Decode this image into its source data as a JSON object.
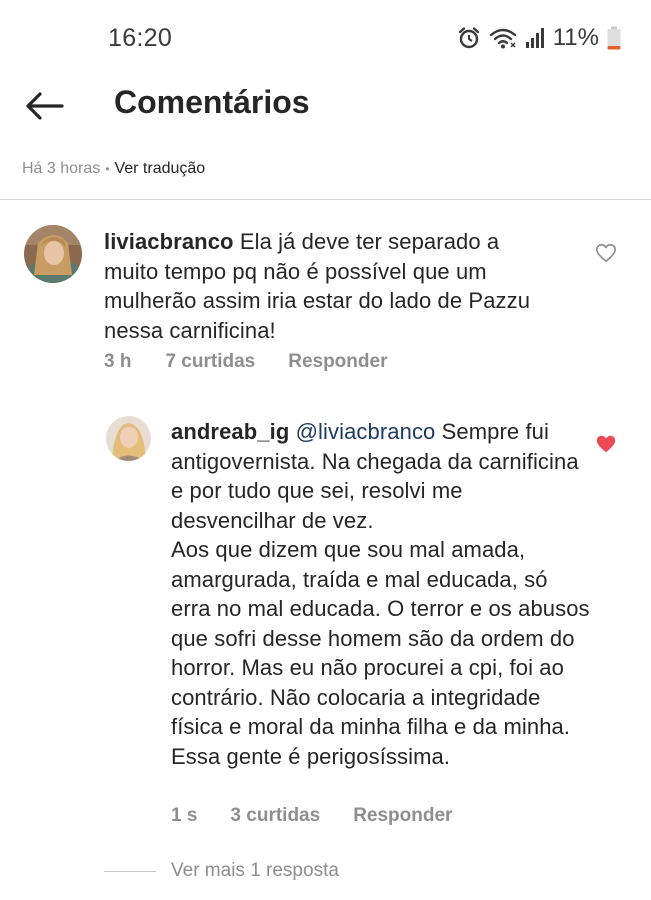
{
  "status_bar": {
    "time": "16:20",
    "battery": "11%",
    "icons": [
      "alarm-icon",
      "wifi-icon",
      "signal-icon",
      "battery-icon"
    ]
  },
  "header": {
    "title": "Comentários",
    "back_icon": "back-arrow-icon"
  },
  "post_meta": {
    "time_ago": "Há 3 horas",
    "separator": "•",
    "translate_label": "Ver tradução"
  },
  "comments": [
    {
      "username": "liviacbranco",
      "mention": "",
      "text": "Ela já deve ter separado a muito tempo pq não é possível que um mulherão assim iria estar do lado de Pazzu nessa carnificina!",
      "time": "3 h",
      "likes": "7 curtidas",
      "reply_label": "Responder",
      "liked": false
    },
    {
      "username": "andreab_ig",
      "mention": "@liviacbranco",
      "text": "Sempre fui antigovernista. Na chegada da carnificina e por tudo que sei, resolvi me desvencilhar de vez.\nAos que dizem que sou mal amada, amargurada, traída e mal educada, só erra no mal educada. O terror e os abusos que sofri desse homem são da ordem do horror. Mas eu não procurei a cpi, foi ao contrário. Não colocaria a integridade física e moral da minha filha e da minha. Essa gente é perigosíssima.",
      "time": "1 s",
      "likes": "3 curtidas",
      "reply_label": "Responder",
      "liked": true
    }
  ],
  "view_more": "Ver mais 1 resposta",
  "colors": {
    "like_active": "#ed4956",
    "like_inactive": "#8e8e8e",
    "mention": "#1f3a63",
    "muted": "#8e8e8e"
  }
}
